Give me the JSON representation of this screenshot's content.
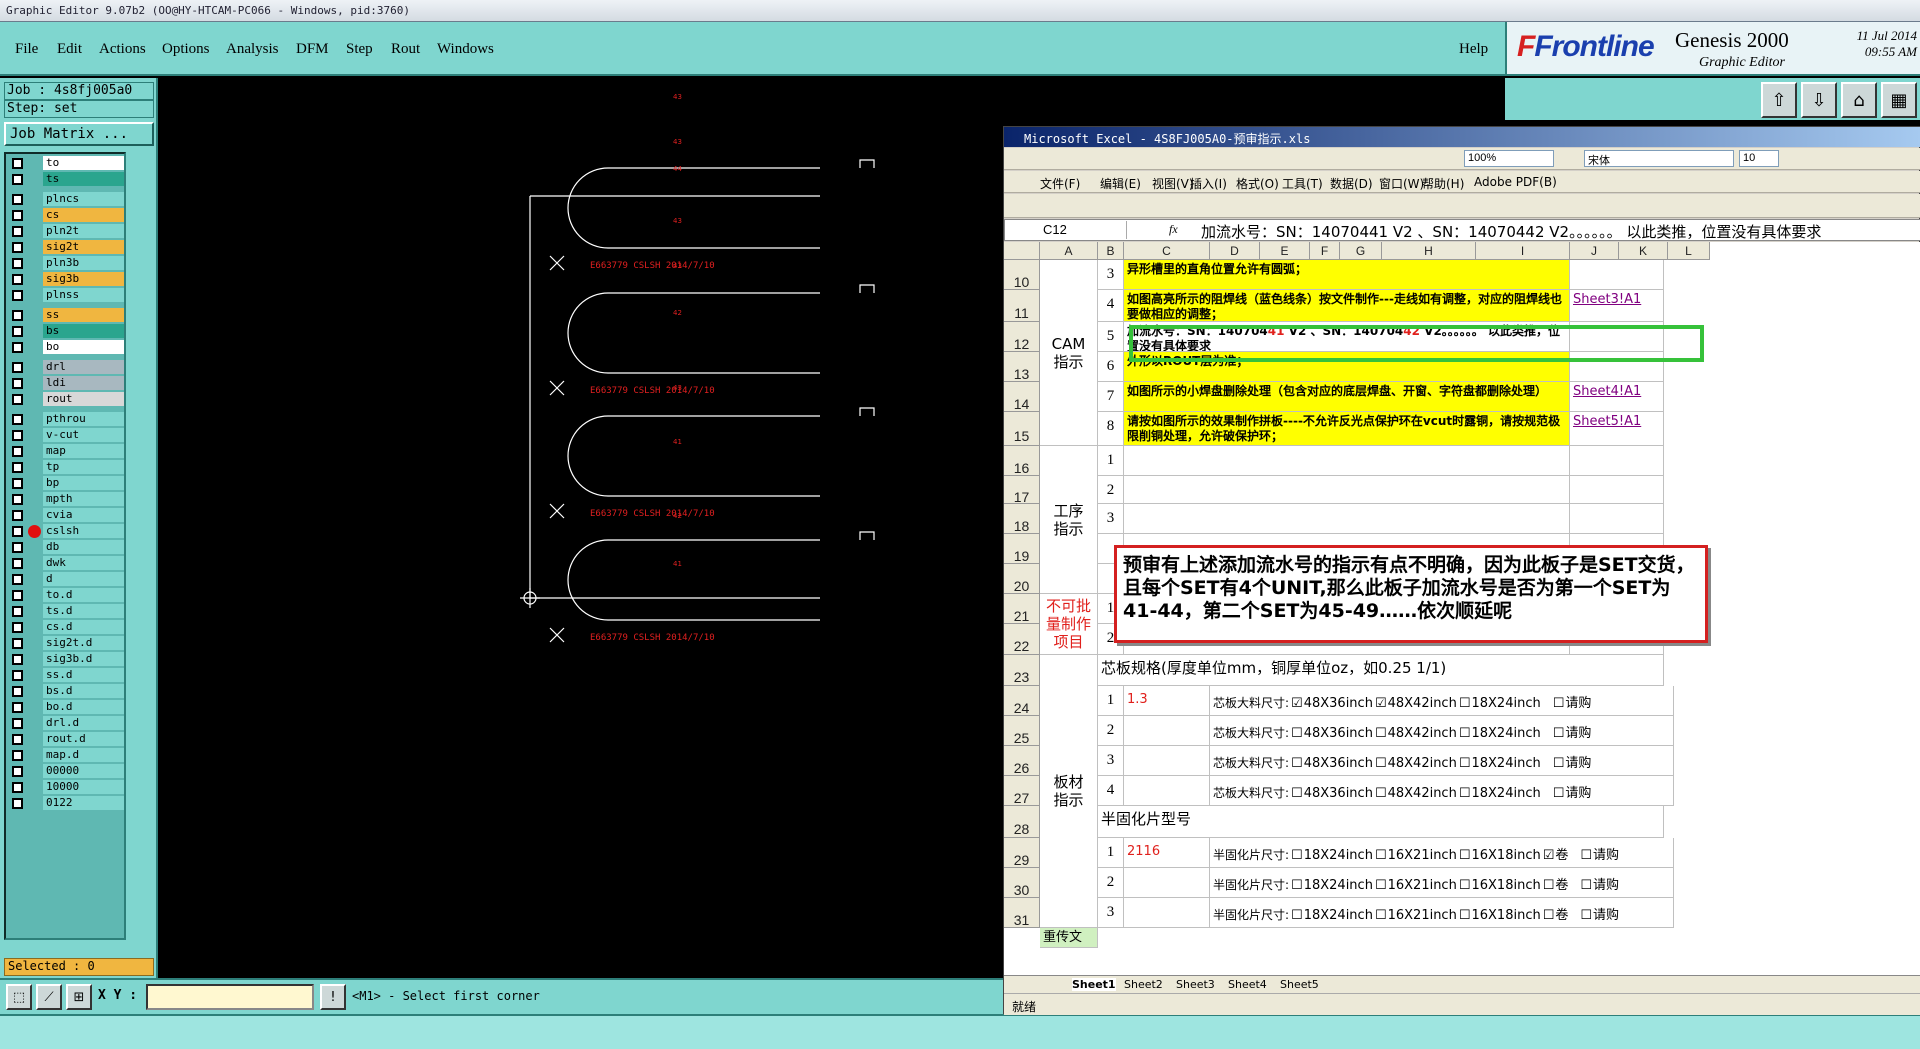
{
  "window_title": "Graphic Editor 9.07b2 (OO@HY-HTCAM-PC066 - Windows, pid:3760)",
  "menu": [
    "File",
    "Edit",
    "Actions",
    "Options",
    "Analysis",
    "DFM",
    "Step",
    "Rout",
    "Windows"
  ],
  "help": "Help",
  "brand": {
    "logo_a": "F",
    "logo_b": "Frontline",
    "product": "Genesis 2000",
    "sub": "Graphic Editor",
    "date": "11 Jul 2014",
    "time": "09:55 AM"
  },
  "job": "Job : 4s8fj005a0",
  "step": "Step: set",
  "job_matrix": "Job Matrix ...",
  "layers": [
    {
      "name": "to",
      "color": "#ffffff"
    },
    {
      "name": "ts",
      "color": "#2aa58e"
    },
    {
      "name": "plncs",
      "color": "#7fd6cf"
    },
    {
      "name": "cs",
      "color": "#f0b640"
    },
    {
      "name": "pln2t",
      "color": "#7fd6cf"
    },
    {
      "name": "sig2t",
      "color": "#f0b640"
    },
    {
      "name": "pln3b",
      "color": "#7fd6cf"
    },
    {
      "name": "sig3b",
      "color": "#f0b640"
    },
    {
      "name": "plnss",
      "color": "#7fd6cf"
    },
    {
      "name": "ss",
      "color": "#f0b640"
    },
    {
      "name": "bs",
      "color": "#2aa58e"
    },
    {
      "name": "bo",
      "color": "#ffffff"
    },
    {
      "name": "drl",
      "color": "#a8b8c0"
    },
    {
      "name": "ldi",
      "color": "#a8b8c0"
    },
    {
      "name": "rout",
      "color": "#d8d8d8"
    },
    {
      "name": "pthrou",
      "color": "#7fd6cf"
    },
    {
      "name": "v-cut",
      "color": "#7fd6cf"
    },
    {
      "name": "map",
      "color": "#7fd6cf"
    },
    {
      "name": "tp",
      "color": "#7fd6cf"
    },
    {
      "name": "bp",
      "color": "#7fd6cf"
    },
    {
      "name": "mpth",
      "color": "#7fd6cf"
    },
    {
      "name": "cvia",
      "color": "#7fd6cf"
    },
    {
      "name": "cslsh",
      "color": "#7fd6cf"
    },
    {
      "name": "db",
      "color": "#7fd6cf"
    },
    {
      "name": "dwk",
      "color": "#7fd6cf"
    },
    {
      "name": "d",
      "color": "#7fd6cf"
    },
    {
      "name": "to.d",
      "color": "#7fd6cf"
    },
    {
      "name": "ts.d",
      "color": "#7fd6cf"
    },
    {
      "name": "cs.d",
      "color": "#7fd6cf"
    },
    {
      "name": "sig2t.d",
      "color": "#7fd6cf"
    },
    {
      "name": "sig3b.d",
      "color": "#7fd6cf"
    },
    {
      "name": "ss.d",
      "color": "#7fd6cf"
    },
    {
      "name": "bs.d",
      "color": "#7fd6cf"
    },
    {
      "name": "bo.d",
      "color": "#7fd6cf"
    },
    {
      "name": "drl.d",
      "color": "#7fd6cf"
    },
    {
      "name": "rout.d",
      "color": "#7fd6cf"
    },
    {
      "name": "map.d",
      "color": "#7fd6cf"
    },
    {
      "name": "00000",
      "color": "#7fd6cf"
    },
    {
      "name": "10000",
      "color": "#7fd6cf"
    },
    {
      "name": "0122",
      "color": "#7fd6cf"
    }
  ],
  "selected": "Selected : 0",
  "xy_label": "X Y :",
  "prompt": "<M1> - Select first corner",
  "canvas_labels": {
    "stamp": "E663779 CSLSH 2014/7/10",
    "n43": "43",
    "n44": "44",
    "n42": "42",
    "n41": "41"
  },
  "excel": {
    "title": "Microsoft Excel - 4S8FJ005A0-预审指示.xls",
    "menu": [
      "文件(F)",
      "编辑(E)",
      "视图(V)",
      "插入(I)",
      "格式(O)",
      "工具(T)",
      "数据(D)",
      "窗口(W)",
      "帮助(H)",
      "Adobe PDF(B)"
    ],
    "zoom": "100%",
    "font": "宋体",
    "font_size": "10",
    "cell_ref": "C12",
    "fx": "fx",
    "formula": "加流水号：SN：14070441 V2 、SN：14070442 V2。。。。。。  以此类推，位置没有具体要求",
    "columns": [
      "A",
      "B",
      "C",
      "D",
      "E",
      "F",
      "G",
      "H",
      "I",
      "J",
      "K",
      "L"
    ],
    "rows": [
      "10",
      "11",
      "12",
      "13",
      "14",
      "15",
      "16",
      "17",
      "18",
      "19",
      "20",
      "21",
      "22",
      "23",
      "24",
      "25",
      "26",
      "27",
      "28",
      "29",
      "30",
      "31"
    ],
    "cam_group": "CAM\n指示",
    "process_group": "工序\n指示",
    "no_batch": "不可批\n量制作\n项目",
    "board_group": "板材\n指示",
    "upload": "重传文",
    "r10": {
      "n": "3",
      "text": "异形槽里的直角位置允许有圆弧；"
    },
    "r11": {
      "n": "4",
      "text": "如图高亮所示的阻焊线（蓝色线条）按文件制作---走线如有调整，对应的阻焊线也要做相应的调整；",
      "link": "Sheet3!A1"
    },
    "r12": {
      "n": "5",
      "a": "加流水号：SN：140704",
      "b": "41",
      "c": " V2 、SN：140704",
      "d": "42",
      "e": " V2。。。。。。  以此类推，位置没有具体要求"
    },
    "r13": {
      "n": "6",
      "text": "外形以ROUT层为准；"
    },
    "r14": {
      "n": "7",
      "text": "如图所示的小焊盘删除处理（包含对应的底层焊盘、开窗、字符盘都删除处理）",
      "link": "Sheet4!A1"
    },
    "r15": {
      "n": "8",
      "text": "请按如图所示的效果制作拼板----不允许反光点保护环在vcut时露铜，请按规范极限削铜处理，允许破保护环；",
      "link": "Sheet5!A1"
    },
    "process_nums": [
      "1",
      "2",
      "3"
    ],
    "nb_nums": [
      "1",
      "2"
    ],
    "core_header": "芯板规格(厚度单位mm，铜厚单位oz，如0.25 1/1)",
    "core_rows": [
      {
        "n": "1",
        "val": "1.3",
        "label": "芯板大料尺寸:",
        "o1": "48X36inch",
        "o2": "48X42inch",
        "o3": "18X24inch",
        "o4": "请购",
        "c1": true,
        "c2": true
      },
      {
        "n": "2",
        "val": "",
        "label": "芯板大料尺寸:",
        "o1": "48X36inch",
        "o2": "48X42inch",
        "o3": "18X24inch",
        "o4": "请购",
        "c1": false,
        "c2": false
      },
      {
        "n": "3",
        "val": "",
        "label": "芯板大料尺寸:",
        "o1": "48X36inch",
        "o2": "48X42inch",
        "o3": "18X24inch",
        "o4": "请购",
        "c1": false,
        "c2": false
      },
      {
        "n": "4",
        "val": "",
        "label": "芯板大料尺寸:",
        "o1": "48X36inch",
        "o2": "48X42inch",
        "o3": "18X24inch",
        "o4": "请购",
        "c1": false,
        "c2": false
      }
    ],
    "pp_header": "半固化片型号",
    "pp_rows": [
      {
        "n": "1",
        "val": "2116",
        "label": "半固化片尺寸:",
        "o1": "18X24inch",
        "o2": "16X21inch",
        "o3": "16X18inch",
        "o4": "卷",
        "o5": "请购",
        "c4": true
      },
      {
        "n": "2",
        "val": "",
        "label": "半固化片尺寸:",
        "o1": "18X24inch",
        "o2": "16X21inch",
        "o3": "16X18inch",
        "o4": "卷",
        "o5": "请购",
        "c4": false
      },
      {
        "n": "3",
        "val": "",
        "label": "半固化片尺寸:",
        "o1": "18X24inch",
        "o2": "16X21inch",
        "o3": "16X18inch",
        "o4": "卷",
        "o5": "请购",
        "c4": false
      }
    ],
    "sheets": [
      "Sheet1",
      "Sheet2",
      "Sheet3",
      "Sheet4",
      "Sheet5"
    ],
    "status": "就绪"
  },
  "note": "预审有上述添加流水号的指示有点不明确，因为此板子是SET交货，且每个SET有4个UNIT,那么此板子加流水号是否为第一个SET为41-44，第二个SET为45-49……依次顺延呢"
}
